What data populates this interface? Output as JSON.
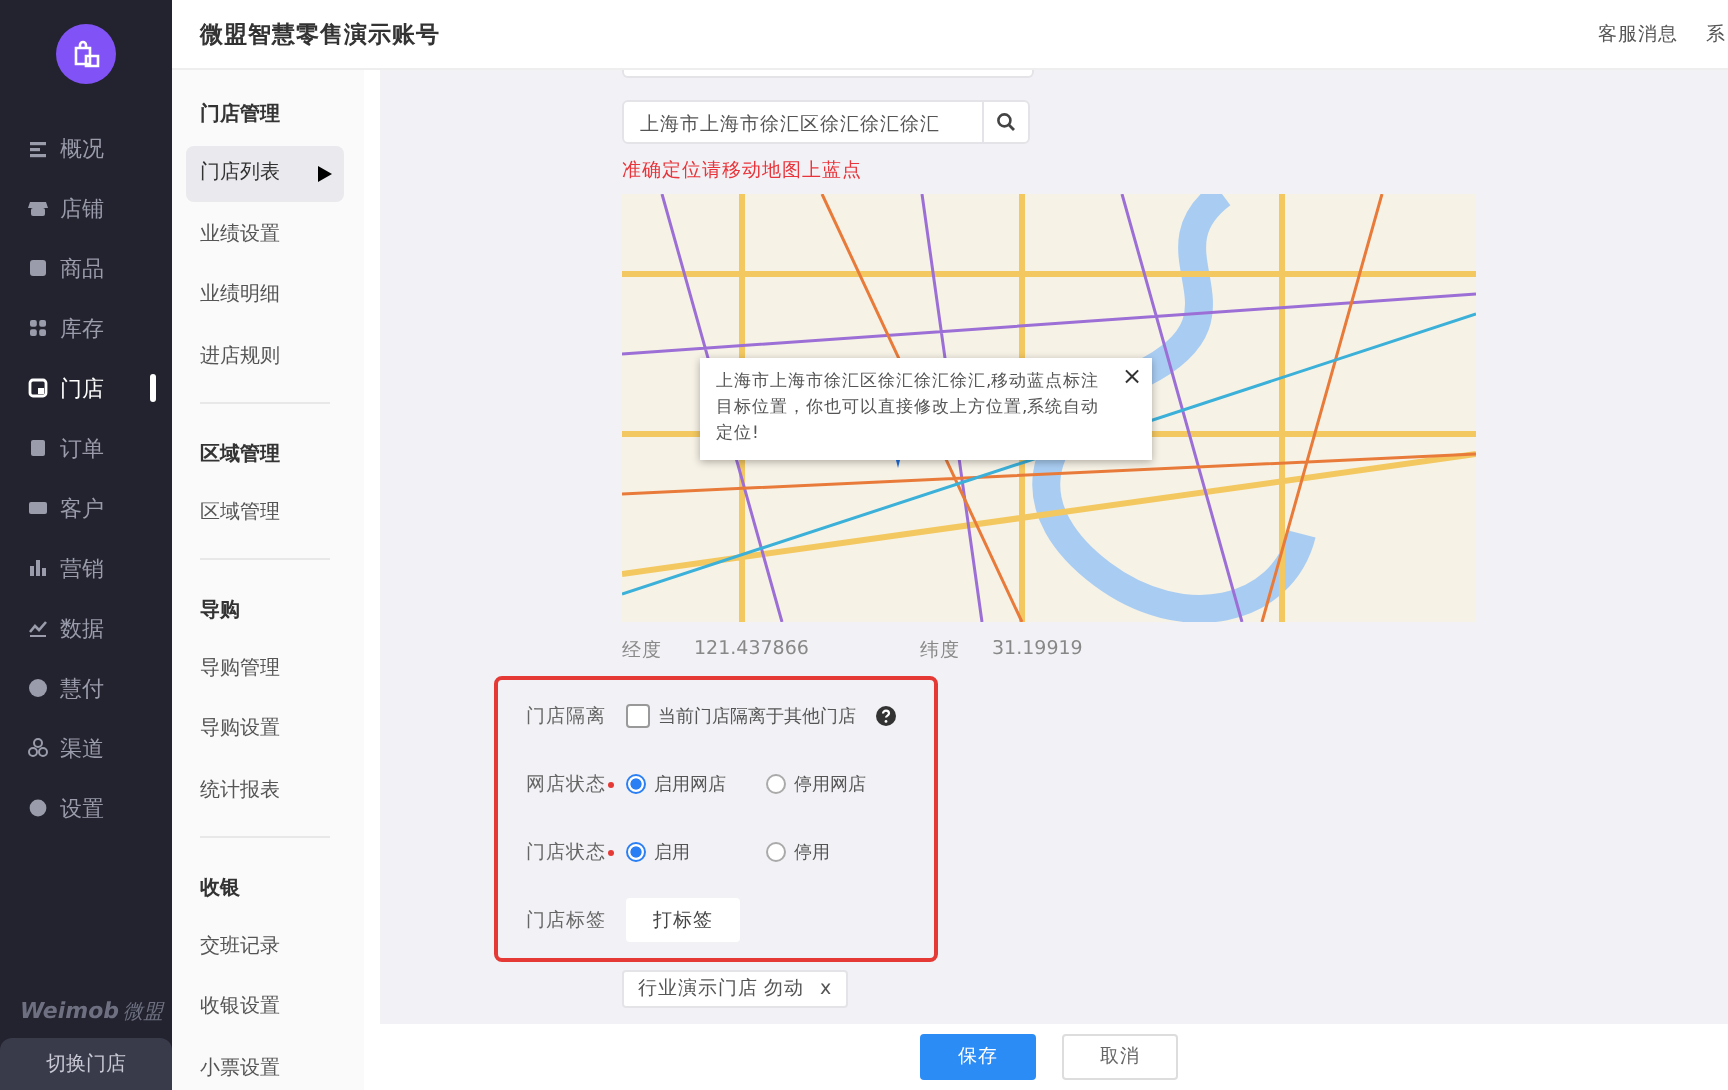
{
  "sidebar": {
    "items": [
      {
        "label": "概况",
        "selected": false
      },
      {
        "label": "店铺",
        "selected": false
      },
      {
        "label": "商品",
        "selected": false
      },
      {
        "label": "库存",
        "selected": false
      },
      {
        "label": "门店",
        "selected": true
      },
      {
        "label": "订单",
        "selected": false
      },
      {
        "label": "客户",
        "selected": false
      },
      {
        "label": "营销",
        "selected": false
      },
      {
        "label": "数据",
        "selected": false
      },
      {
        "label": "慧付",
        "selected": false
      },
      {
        "label": "渠道",
        "selected": false
      },
      {
        "label": "设置",
        "selected": false
      }
    ],
    "brand": "Weimob",
    "brand_cn": "微盟",
    "switch_button": "切换门店"
  },
  "header": {
    "title": "微盟智慧零售演示账号",
    "links": [
      "客服消息",
      "系"
    ]
  },
  "subnav": {
    "groups": [
      {
        "title": "门店管理",
        "items": [
          {
            "label": "门店列表",
            "selected": true
          },
          {
            "label": "业绩设置",
            "selected": false
          },
          {
            "label": "业绩明细",
            "selected": false
          },
          {
            "label": "进店规则",
            "selected": false
          }
        ]
      },
      {
        "title": "区域管理",
        "items": [
          {
            "label": "区域管理",
            "selected": false
          }
        ]
      },
      {
        "title": "导购",
        "items": [
          {
            "label": "导购管理",
            "selected": false
          },
          {
            "label": "导购设置",
            "selected": false
          },
          {
            "label": "统计报表",
            "selected": false
          }
        ]
      },
      {
        "title": "收银",
        "items": [
          {
            "label": "交班记录",
            "selected": false
          },
          {
            "label": "收银设置",
            "selected": false
          },
          {
            "label": "小票设置",
            "selected": false
          }
        ]
      }
    ]
  },
  "form": {
    "address": {
      "value": "上海市上海市徐汇区徐汇徐汇徐汇"
    },
    "hint": "准确定位请移动地图上蓝点",
    "map": {
      "popup": "上海市上海市徐汇区徐汇徐汇徐汇,移动蓝点标注目标位置，你也可以直接修改上方位置,系统自动定位!",
      "close": "×"
    },
    "coordinates": [
      {
        "label": "经度",
        "value": "121.437866"
      },
      {
        "label": "纬度",
        "value": "31.19919"
      }
    ],
    "rows": [
      {
        "kind": "checkbox",
        "label": "门店隔离",
        "required": false,
        "text": "当前门店隔离于其他门店",
        "checked": false
      },
      {
        "kind": "radio",
        "label": "网店状态",
        "required": true,
        "options": [
          {
            "label": "启用网店",
            "selected": true
          },
          {
            "label": "停用网店",
            "selected": false
          }
        ]
      },
      {
        "kind": "radio",
        "label": "门店状态",
        "required": true,
        "options": [
          {
            "label": "启用",
            "selected": true
          },
          {
            "label": "停用",
            "selected": false
          }
        ]
      },
      {
        "kind": "tags",
        "label": "门店标签",
        "required": false,
        "button": "打标签"
      }
    ],
    "chips": [
      {
        "label": "行业演示门店 勿动",
        "remove": "x"
      }
    ]
  },
  "footer": {
    "buttons": [
      {
        "label": "保存",
        "kind": "primary"
      },
      {
        "label": "取消",
        "kind": "default"
      }
    ]
  }
}
